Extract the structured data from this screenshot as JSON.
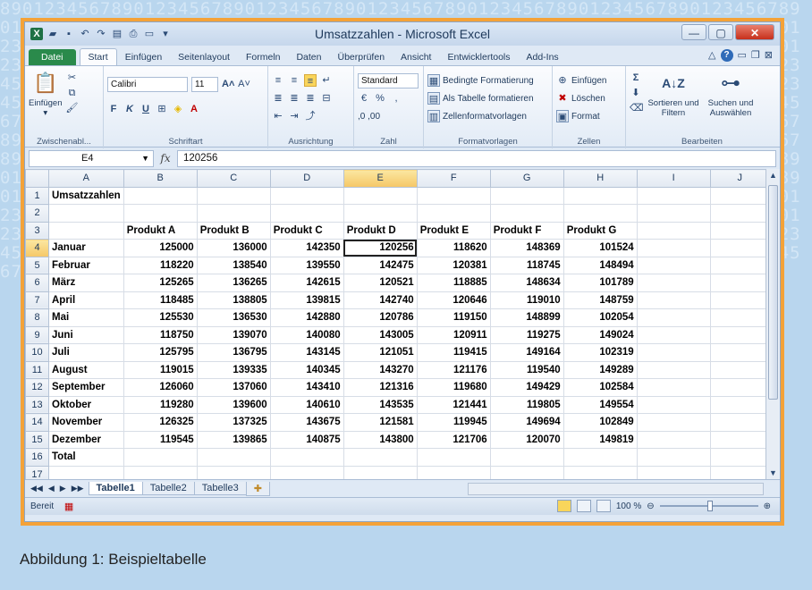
{
  "window": {
    "title": "Umsatzzahlen - Microsoft Excel"
  },
  "ribbon": {
    "tabs": [
      "Datei",
      "Start",
      "Einfügen",
      "Seitenlayout",
      "Formeln",
      "Daten",
      "Überprüfen",
      "Ansicht",
      "Entwicklertools",
      "Add-Ins"
    ],
    "active_tab": "Start",
    "groups": {
      "clipboard": {
        "label": "Zwischenabl...",
        "paste": "Einfügen"
      },
      "font": {
        "label": "Schriftart",
        "font_name": "Calibri",
        "font_size": "11",
        "bold": "F",
        "italic": "K",
        "underline": "U"
      },
      "alignment": {
        "label": "Ausrichtung"
      },
      "number": {
        "label": "Zahl",
        "format": "Standard",
        "percent": "%",
        "thousands": ",",
        "inc_dec": ",0 ,00"
      },
      "styles": {
        "label": "Formatvorlagen",
        "conditional": "Bedingte Formatierung",
        "as_table": "Als Tabelle formatieren",
        "cell_styles": "Zellenformatvorlagen"
      },
      "cells": {
        "label": "Zellen",
        "insert": "Einfügen",
        "delete": "Löschen",
        "format": "Format"
      },
      "editing": {
        "label": "Bearbeiten",
        "sort": "Sortieren und Filtern",
        "find": "Suchen und Auswählen",
        "sigma": "Σ"
      }
    }
  },
  "formula_bar": {
    "name_box": "E4",
    "fx": "fx",
    "value": "120256"
  },
  "sheet": {
    "columns": [
      "A",
      "B",
      "C",
      "D",
      "E",
      "F",
      "G",
      "H",
      "I",
      "J"
    ],
    "active_cell": "E4",
    "rows": [
      [
        "Umsatzzahlen",
        "",
        "",
        "",
        "",
        "",
        "",
        ""
      ],
      [
        "",
        "",
        "",
        "",
        "",
        "",
        "",
        ""
      ],
      [
        "",
        "Produkt A",
        "Produkt B",
        "Produkt C",
        "Produkt D",
        "Produkt E",
        "Produkt F",
        "Produkt G"
      ],
      [
        "Januar",
        "125000",
        "136000",
        "142350",
        "120256",
        "118620",
        "148369",
        "101524"
      ],
      [
        "Februar",
        "118220",
        "138540",
        "139550",
        "142475",
        "120381",
        "118745",
        "148494"
      ],
      [
        "März",
        "125265",
        "136265",
        "142615",
        "120521",
        "118885",
        "148634",
        "101789"
      ],
      [
        "April",
        "118485",
        "138805",
        "139815",
        "142740",
        "120646",
        "119010",
        "148759"
      ],
      [
        "Mai",
        "125530",
        "136530",
        "142880",
        "120786",
        "119150",
        "148899",
        "102054"
      ],
      [
        "Juni",
        "118750",
        "139070",
        "140080",
        "143005",
        "120911",
        "119275",
        "149024"
      ],
      [
        "Juli",
        "125795",
        "136795",
        "143145",
        "121051",
        "119415",
        "149164",
        "102319"
      ],
      [
        "August",
        "119015",
        "139335",
        "140345",
        "143270",
        "121176",
        "119540",
        "149289"
      ],
      [
        "September",
        "126060",
        "137060",
        "143410",
        "121316",
        "119680",
        "149429",
        "102584"
      ],
      [
        "Oktober",
        "119280",
        "139600",
        "140610",
        "143535",
        "121441",
        "119805",
        "149554"
      ],
      [
        "November",
        "126325",
        "137325",
        "143675",
        "121581",
        "119945",
        "149694",
        "102849"
      ],
      [
        "Dezember",
        "119545",
        "139865",
        "140875",
        "143800",
        "121706",
        "120070",
        "149819"
      ],
      [
        "Total",
        "",
        "",
        "",
        "",
        "",
        "",
        ""
      ]
    ],
    "tabs": [
      "Tabelle1",
      "Tabelle2",
      "Tabelle3"
    ],
    "active_tab": "Tabelle1"
  },
  "status": {
    "ready": "Bereit",
    "zoom": "100 %"
  },
  "caption": "Abbildung 1: Beispieltabelle",
  "background_digits": "8901234567890123456789012345678901234567890123456789012345678901234567890123456789012345678901234567890123456789012345678901234567890123456789012345678901234567890123456789"
}
